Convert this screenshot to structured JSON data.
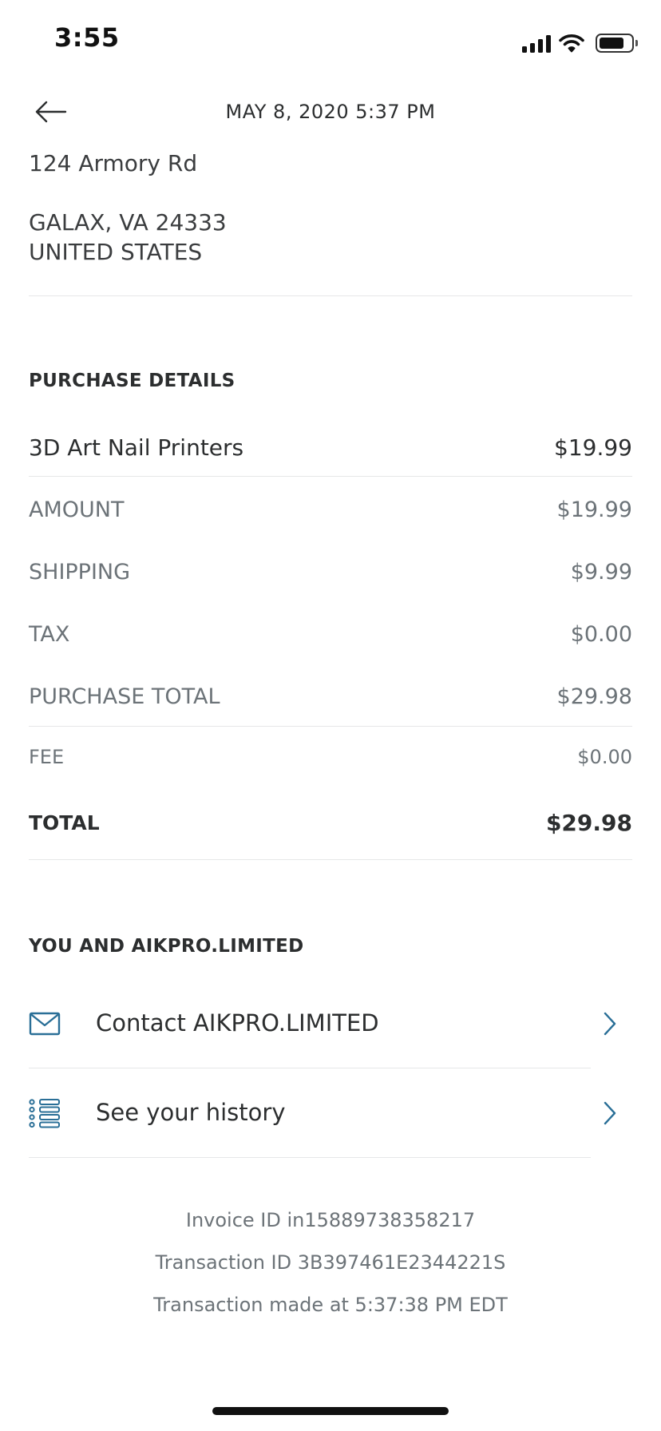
{
  "status_bar": {
    "time": "3:55"
  },
  "header": {
    "title": "MAY 8, 2020  5:37 PM"
  },
  "address": {
    "street": "124 Armory Rd",
    "city_line": "GALAX, VA 24333",
    "country": "UNITED STATES"
  },
  "purchase": {
    "section_title": "PURCHASE DETAILS",
    "item": {
      "name": "3D Art Nail Printers",
      "price": "$19.99"
    },
    "amount": {
      "label": "AMOUNT",
      "value": "$19.99"
    },
    "shipping": {
      "label": "SHIPPING",
      "value": "$9.99"
    },
    "tax": {
      "label": "TAX",
      "value": "$0.00"
    },
    "purchase_total": {
      "label": "PURCHASE TOTAL",
      "value": "$29.98"
    },
    "fee": {
      "label": "FEE",
      "value": "$0.00"
    },
    "total": {
      "label": "TOTAL",
      "value": "$29.98"
    }
  },
  "merchant": {
    "section_title": "YOU AND AIKPRO.LIMITED",
    "contact_label": "Contact AIKPRO.LIMITED",
    "history_label": "See your history"
  },
  "footer": {
    "invoice": "Invoice ID in15889738358217",
    "transaction": "Transaction ID 3B397461E2344221S",
    "made_at": "Transaction made at 5:37:38 PM EDT"
  },
  "icons": {
    "back": "arrow-left-icon",
    "contact": "envelope-icon",
    "history": "list-icon",
    "chevron": "chevron-right-icon"
  },
  "colors": {
    "accent": "#2a6f97",
    "text_primary": "#2c2e2f",
    "text_secondary": "#6c7378",
    "divider": "#e6e7e8"
  }
}
